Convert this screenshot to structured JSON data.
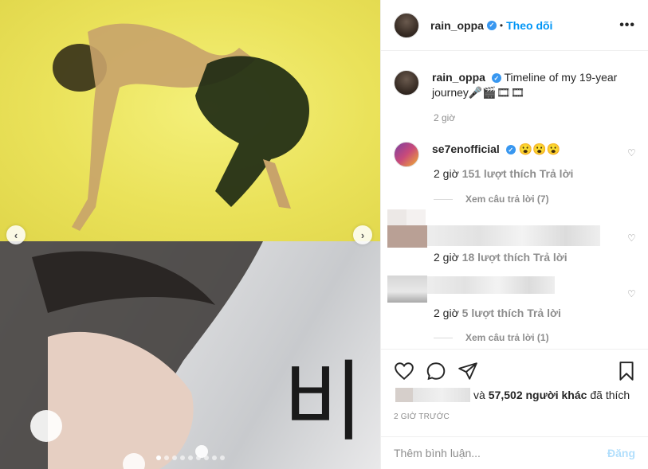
{
  "header": {
    "username": "rain_oppa",
    "separator": "•",
    "follow_label": "Theo dõi",
    "more_label": "•••"
  },
  "caption": {
    "username": "rain_oppa",
    "text": "Timeline of my 19-year journey🎤🎬🎞🎞",
    "time": "2 giờ"
  },
  "comments": [
    {
      "username": "se7enofficial",
      "text": "😮😮😮",
      "time": "2 giờ",
      "likes": "151 lượt thích",
      "reply_label": "Trả lời",
      "view_replies": "Xem câu trả lời (7)"
    },
    {
      "username": "",
      "text": "",
      "time": "2 giờ",
      "likes": "18 lượt thích",
      "reply_label": "Trả lời"
    },
    {
      "username": "",
      "text": "",
      "time": "2 giờ",
      "likes": "5 lượt thích",
      "reply_label": "Trả lời",
      "view_replies": "Xem câu trả lời (1)"
    }
  ],
  "likes": {
    "and_label": "và",
    "count_text": "57,502 người khác",
    "suffix": "đã thích"
  },
  "time_ago": "2 GIỜ TRƯỚC",
  "add_comment": {
    "placeholder": "Thêm bình luận...",
    "post_label": "Đăng"
  },
  "media": {
    "prev_arrow": "‹",
    "next_arrow": "›",
    "slide_count": 9,
    "active_slide": 0
  },
  "icons": {
    "verified": "✓",
    "heart": "♡"
  },
  "colors": {
    "accent": "#0095f6",
    "verified": "#3897f0",
    "muted": "#8e8e8e",
    "post_disabled": "#b2dffc"
  }
}
